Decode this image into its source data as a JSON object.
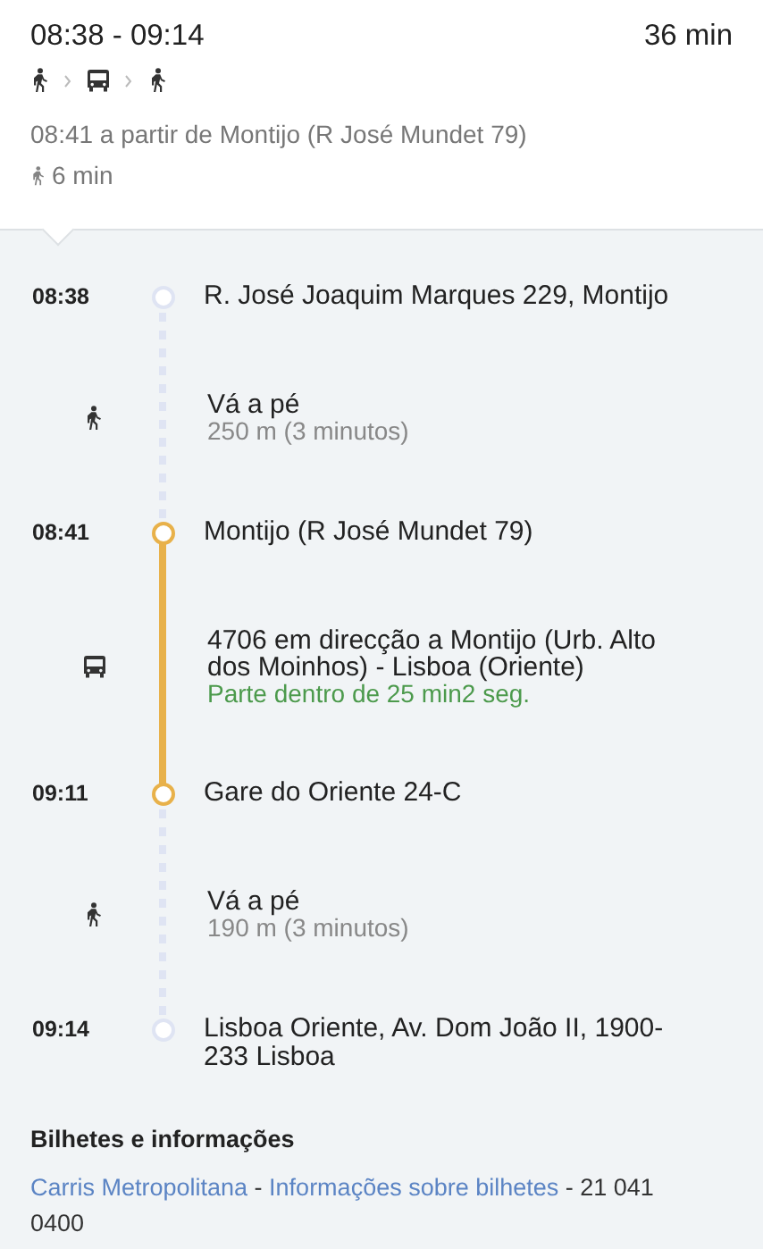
{
  "summary": {
    "times": "08:38 - 09:14",
    "duration": "36 min",
    "modes": [
      {
        "kind": "walk"
      },
      {
        "kind": "bus"
      },
      {
        "kind": "walk"
      }
    ],
    "departure": "08:41 a partir de Montijo (R José Mundet 79)",
    "walk_total": "6 min"
  },
  "steps": [
    {
      "kind": "stop",
      "color": "#dfe4f3",
      "time": "08:38",
      "place": "R. José Joaquim Marques 229, Montijo"
    },
    {
      "kind": "walk",
      "title": "Vá a pé",
      "detail": "250 m (3 minutos)"
    },
    {
      "kind": "stop",
      "color": "#e8b14a",
      "time": "08:41",
      "place": "Montijo (R José Mundet 79)"
    },
    {
      "kind": "bus",
      "title": "4706 em direcção a Montijo (Urb. Alto dos Moinhos) - Lisboa (Oriente)",
      "detail": "Parte dentro de 25 min2 seg."
    },
    {
      "kind": "stop",
      "color": "#e8b14a",
      "time": "09:11",
      "place": "Gare do Oriente 24-C"
    },
    {
      "kind": "walk",
      "title": "Vá a pé",
      "detail": "190 m (3 minutos)"
    },
    {
      "kind": "stop",
      "color": "#dfe4f3",
      "time": "09:14",
      "place": "Lisboa Oriente, Av. Dom João II, 1900-233 Lisboa"
    }
  ],
  "tickets": {
    "title": "Bilhetes e informações",
    "parts": [
      {
        "kind": "link",
        "text": "Carris Metropolitana"
      },
      {
        "kind": "text",
        "text": " - "
      },
      {
        "kind": "link",
        "text": "Informações sobre bilhetes"
      },
      {
        "kind": "text",
        "text": " - 21 041 0400"
      }
    ]
  }
}
